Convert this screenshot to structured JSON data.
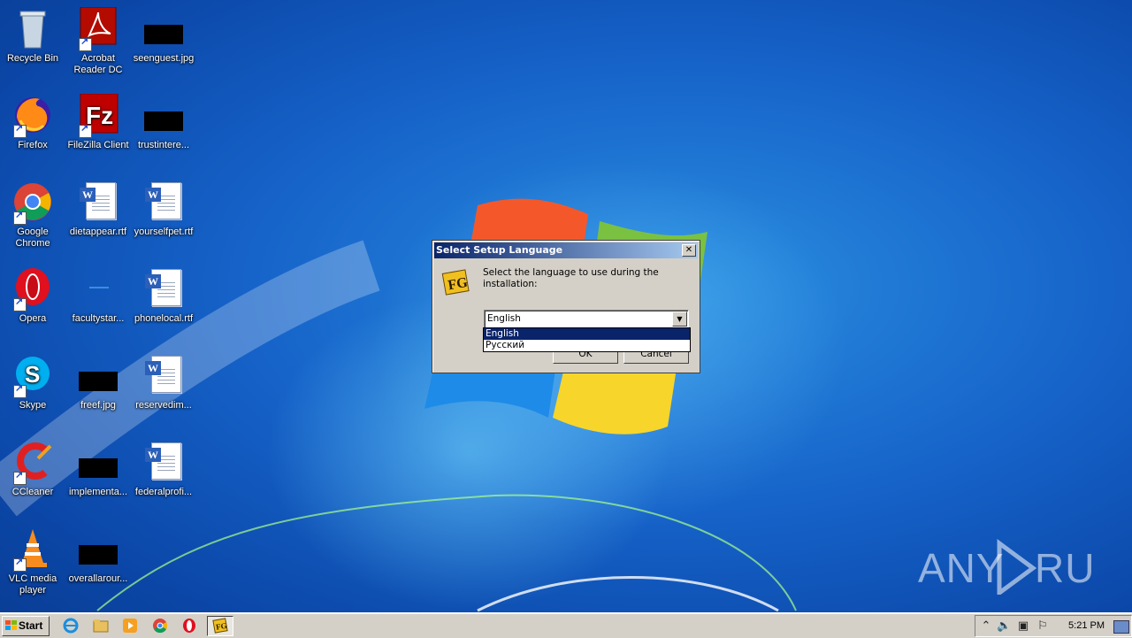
{
  "desktop": {
    "icons": [
      {
        "label": "Recycle Bin",
        "icon": "recycle-bin-icon"
      },
      {
        "label": "Acrobat Reader DC",
        "icon": "acrobat-icon"
      },
      {
        "label": "seenguest.jpg",
        "icon": "image-file-icon"
      },
      {
        "label": "Firefox",
        "icon": "firefox-icon"
      },
      {
        "label": "FileZilla Client",
        "icon": "filezilla-icon"
      },
      {
        "label": "trustintere...",
        "icon": "image-file-icon"
      },
      {
        "label": "Google Chrome",
        "icon": "chrome-icon"
      },
      {
        "label": "dietappear.rtf",
        "icon": "word-document-icon"
      },
      {
        "label": "yourselfpet.rtf",
        "icon": "word-document-icon"
      },
      {
        "label": "Opera",
        "icon": "opera-icon"
      },
      {
        "label": "facultystar...",
        "icon": "folder-icon"
      },
      {
        "label": "phonelocal.rtf",
        "icon": "word-document-icon"
      },
      {
        "label": "Skype",
        "icon": "skype-icon"
      },
      {
        "label": "freef.jpg",
        "icon": "image-file-icon"
      },
      {
        "label": "reservedim...",
        "icon": "word-document-icon"
      },
      {
        "label": "CCleaner",
        "icon": "ccleaner-icon"
      },
      {
        "label": "implementa...",
        "icon": "image-file-icon"
      },
      {
        "label": "federalprofi...",
        "icon": "word-document-icon"
      },
      {
        "label": "VLC media player",
        "icon": "vlc-icon"
      },
      {
        "label": "overallarour...",
        "icon": "image-file-icon"
      }
    ]
  },
  "dialog": {
    "title": "Select Setup Language",
    "close_label": "✕",
    "prompt": "Select the language to use during the installation:",
    "selected_language": "English",
    "options": [
      "English",
      "Русский"
    ],
    "ok_label": "OK",
    "cancel_label": "Cancel"
  },
  "watermark": {
    "text": "ANY RUN"
  },
  "taskbar": {
    "start_label": "Start",
    "quick_launch": [
      "internet-explorer-icon",
      "explorer-icon",
      "media-player-icon",
      "chrome-icon",
      "opera-icon"
    ],
    "active_task_icon": "setup-icon",
    "clock": "5:21 PM"
  },
  "colors": {
    "titlebar_start": "#0a246a",
    "titlebar_end": "#a6caf0",
    "selection": "#0a246a",
    "desktop": "#1663c9"
  }
}
